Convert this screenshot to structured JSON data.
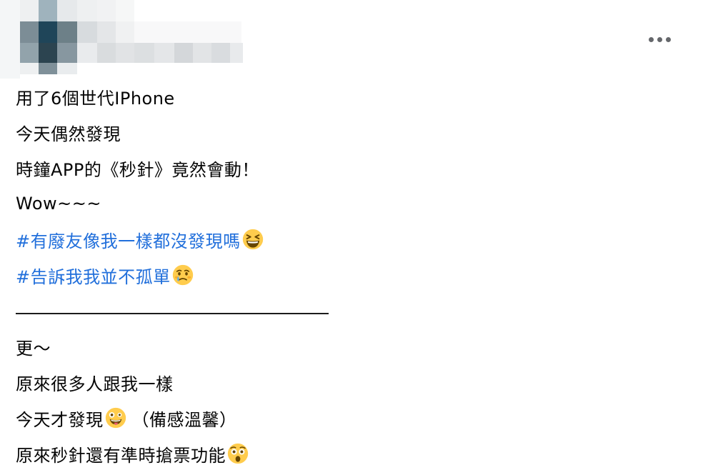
{
  "post": {
    "lines": [
      "用了6個世代IPhone",
      "今天偶然發現",
      "時鐘APP的《秒針》竟然會動！",
      "Wow~~~"
    ],
    "hashtags": [
      "#有廢友像我一樣都沒發現嗎",
      "#告訴我我並不孤單"
    ],
    "after_lines": [
      "更～",
      "原來很多人跟我一樣",
      "今天才發現",
      "（備感溫馨）",
      "原來秒針還有準時搶票功能"
    ]
  },
  "colors": {
    "text": "#050505",
    "hashtag": "#216fdb",
    "icon": "#65676b"
  },
  "icons": {
    "more": "more-horizontal-icon",
    "emoji_1": "grinning-squinting-face-icon",
    "emoji_2": "pleading-tear-face-icon",
    "emoji_3": "zany-face-icon",
    "emoji_4": "astonished-face-icon"
  }
}
